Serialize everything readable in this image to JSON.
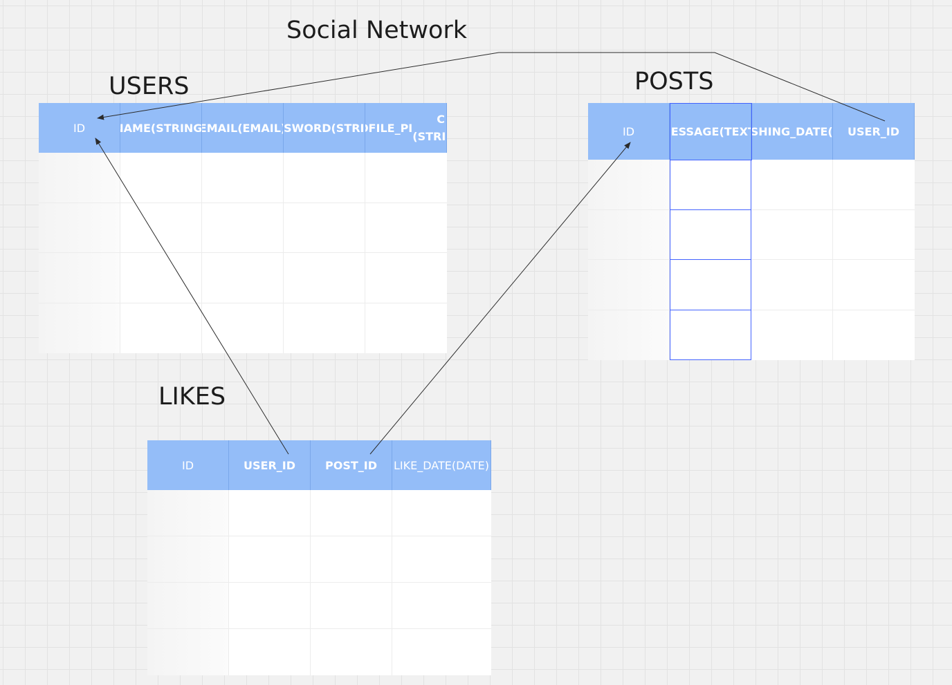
{
  "title": "Social Network",
  "tables": {
    "users": {
      "name": "USERS",
      "columns": [
        "ID",
        "NAME (STRING)",
        "EMAIL (EMAIL)",
        "PASSWORD (STRING)",
        "PROFILE_PIC (STRING)"
      ],
      "column_lines": [
        [
          "ID"
        ],
        [
          "NAME",
          "(STRING)"
        ],
        [
          "EMAIL",
          "(EMAIL)"
        ],
        [
          "PASSWORD",
          "(STRING)"
        ],
        [
          "PROFILE_PI",
          "C (STRING)"
        ]
      ],
      "row_count": 4
    },
    "posts": {
      "name": "POSTS",
      "columns": [
        "ID",
        "MESSAGE (TEXT)",
        "PUBLISHING_DATE (DATE)",
        "USER_ID"
      ],
      "column_lines": [
        [
          "ID"
        ],
        [
          "MESSAGE",
          "(TEXT)"
        ],
        [
          "PUBLISHIN",
          "G_DATE",
          "(DATE)"
        ],
        [
          "USER_ID"
        ]
      ],
      "row_count": 4
    },
    "likes": {
      "name": "LIKES",
      "columns": [
        "ID",
        "USER_ID",
        "POST_ID",
        "LIKE_DATE (DATE)"
      ],
      "column_lines": [
        [
          "ID"
        ],
        [
          "USER_ID"
        ],
        [
          "POST_ID"
        ],
        [
          "LIKE_DATE",
          "(DATE)"
        ]
      ],
      "row_count": 4
    }
  },
  "relationships": [
    {
      "from": "posts.USER_ID",
      "to": "users.ID"
    },
    {
      "from": "likes.USER_ID",
      "to": "users.ID"
    },
    {
      "from": "likes.POST_ID",
      "to": "posts.ID"
    }
  ],
  "colors": {
    "header": "#94bdf8",
    "header_text": "#ffffff",
    "selection": "#4262ff",
    "connector": "#2b2b2b"
  }
}
